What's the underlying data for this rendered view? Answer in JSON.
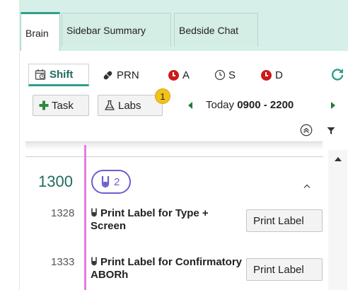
{
  "tabs": [
    {
      "label": "Brain",
      "active": true
    },
    {
      "label": "Sidebar Summary",
      "active": false
    },
    {
      "label": "Bedside Chat",
      "active": false
    }
  ],
  "filters": {
    "shift": "Shift",
    "prn": "PRN",
    "a": "A",
    "s": "S",
    "d": "D"
  },
  "actions": {
    "task_label": "Task",
    "labs_label": "Labs",
    "labs_badge": "1",
    "today": "Today",
    "time_range": "0900 - 2200"
  },
  "timeline": {
    "group_time": "1300",
    "group_lab_count": "2",
    "tasks": [
      {
        "time": "1328",
        "label": "Print Label for Type + Screen",
        "button": "Print Label"
      },
      {
        "time": "1333",
        "label": "Print Label for Confirmatory ABORh",
        "button": "Print Label"
      }
    ]
  },
  "colors": {
    "accent": "#2e9f8a",
    "tab_bg": "#d6efe8",
    "timeline_bar": "#e57de0",
    "lab_purple": "#6a5fd0",
    "alert_red": "#cc1a1a",
    "badge_yellow": "#f2c21a"
  },
  "icons": {
    "shift": "calendar-clock-icon",
    "prn": "pill-icon",
    "a": "red-clock-icon",
    "s": "clock-icon",
    "d": "red-clock-icon",
    "refresh": "refresh-icon",
    "task": "plus-icon",
    "labs": "flask-icon",
    "collapse": "double-chevron-up-icon",
    "filter": "funnel-icon",
    "lab_group": "test-tube-icon"
  }
}
